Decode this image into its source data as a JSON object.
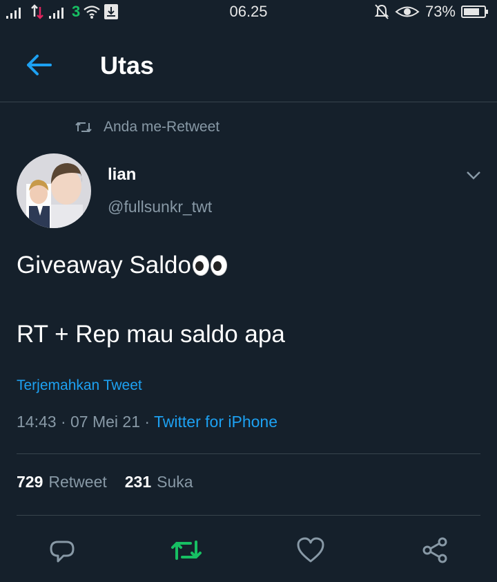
{
  "status_bar": {
    "time": "06.25",
    "battery_percent": "73%",
    "network_label": "3"
  },
  "header": {
    "title": "Utas"
  },
  "retweet_context": {
    "text": "Anda me-Retweet"
  },
  "tweet": {
    "author_name": "lian",
    "author_handle": "@fullsunkr_twt",
    "text_line1": "Giveaway Saldo",
    "text_line2": "RT + Rep mau saldo apa",
    "translate_label": "Terjemahkan Tweet",
    "timestamp": "14:43 · 07 Mei 21 · ",
    "source": "Twitter for iPhone",
    "retweet_count": "729",
    "retweet_label": "Retweet",
    "like_count": "231",
    "like_label": "Suka"
  },
  "icons": {
    "back": "arrow-left-icon",
    "retweet_context": "retweet-icon",
    "caret": "chevron-down-icon",
    "reply": "reply-icon",
    "retweet": "retweet-icon",
    "like": "heart-icon",
    "share": "share-icon"
  },
  "colors": {
    "background": "#15202b",
    "accent": "#1da1f2",
    "secondary_text": "#8899a6",
    "retweeted_green": "#17bf63"
  }
}
